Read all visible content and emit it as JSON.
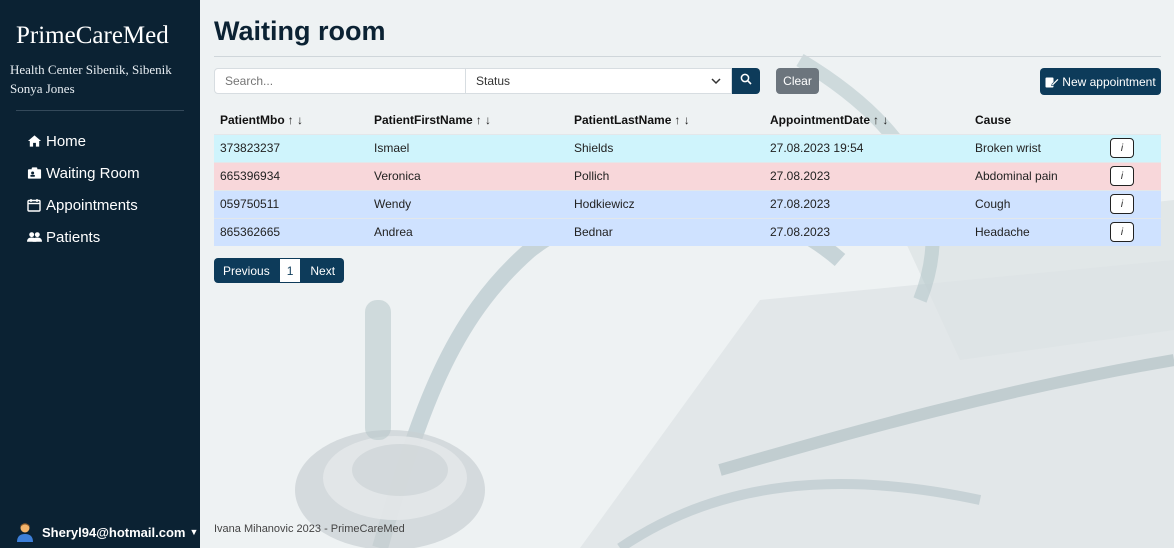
{
  "sidebar": {
    "brand": "PrimeCareMed",
    "center_line": "Health Center Sibenik, Sibenik",
    "user_name": "Sonya Jones",
    "items": [
      {
        "label": "Home",
        "icon": "home-icon"
      },
      {
        "label": "Waiting Room",
        "icon": "waiting-room-icon"
      },
      {
        "label": "Appointments",
        "icon": "calendar-icon"
      },
      {
        "label": "Patients",
        "icon": "users-icon"
      }
    ],
    "account": "Sheryl94@hotmail.com"
  },
  "main": {
    "title": "Waiting room",
    "search_placeholder": "Search...",
    "status_value": "Status",
    "clear_label": "Clear",
    "new_appointment_label": "New appointment",
    "table": {
      "headers": [
        "PatientMbo",
        "PatientFirstName",
        "PatientLastName",
        "AppointmentDate",
        "Cause"
      ],
      "sort_glyph": "↑ ↓",
      "rows": [
        {
          "mbo": "373823237",
          "first": "Ismael",
          "last": "Shields",
          "date": "27.08.2023 19:54",
          "cause": "Broken wrist",
          "row_color": "#cff4fc"
        },
        {
          "mbo": "665396934",
          "first": "Veronica",
          "last": "Pollich",
          "date": "27.08.2023",
          "cause": "Abdominal pain",
          "row_color": "#f8d7da"
        },
        {
          "mbo": "059750511",
          "first": "Wendy",
          "last": "Hodkiewicz",
          "date": "27.08.2023",
          "cause": "Cough",
          "row_color": "#cfe2ff"
        },
        {
          "mbo": "865362665",
          "first": "Andrea",
          "last": "Bednar",
          "date": "27.08.2023",
          "cause": "Headache",
          "row_color": "#cfe2ff"
        }
      ],
      "info_label": "i"
    },
    "pagination": {
      "previous": "Previous",
      "page": "1",
      "next": "Next"
    },
    "footer": "Ivana Mihanovic 2023 - PrimeCareMed"
  },
  "colors": {
    "sidebar": "#0b2233",
    "primary": "#0d3b5a",
    "secondary": "#6c757d"
  }
}
